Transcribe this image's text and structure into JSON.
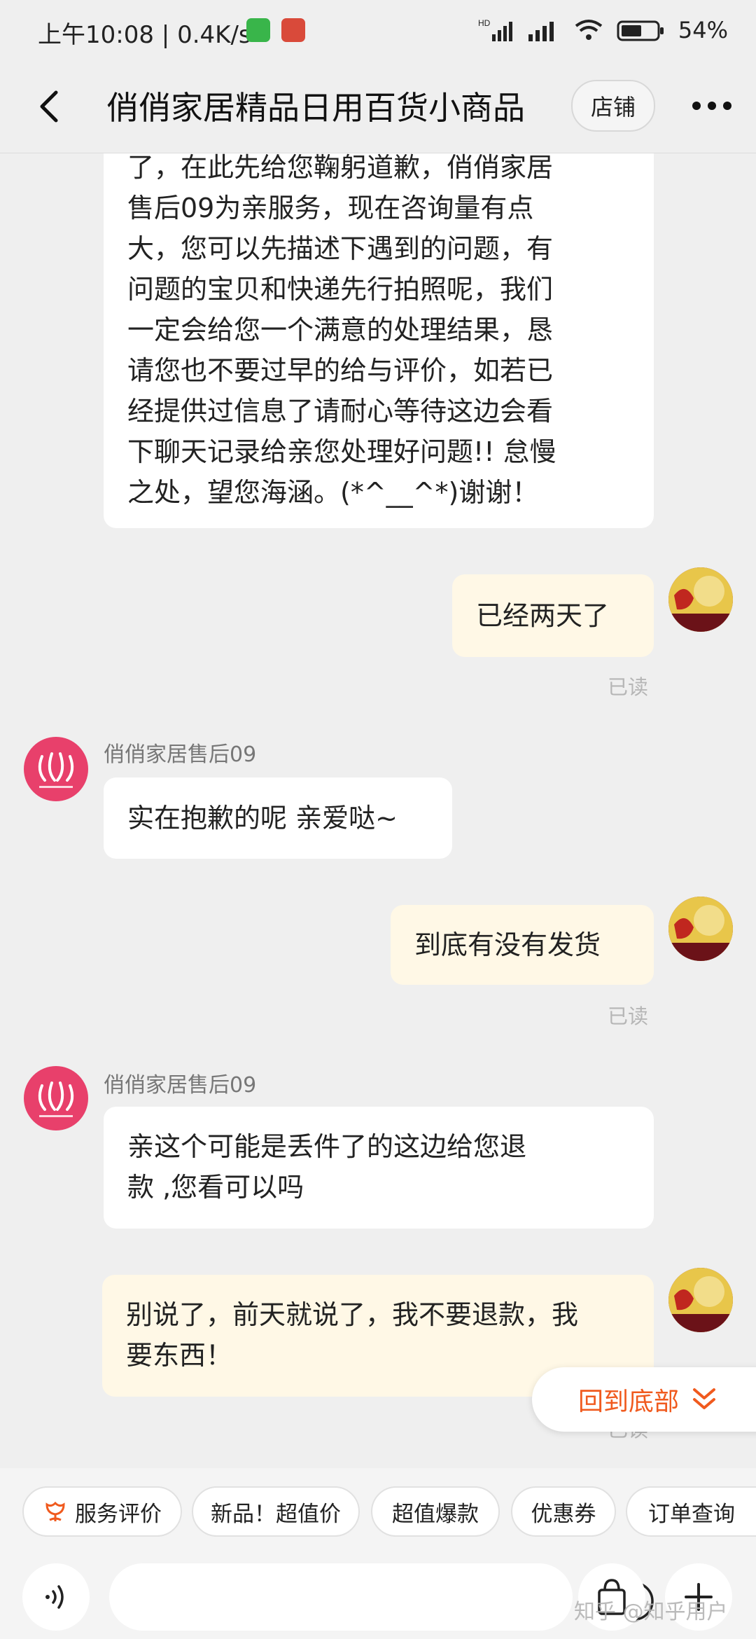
{
  "status_bar": {
    "time": "上午10:08",
    "separator": "|",
    "speed": "0.4K/s",
    "battery": "54%",
    "icons": [
      "wechat-icon",
      "toutiao-icon",
      "hd-signal-icon",
      "signal-icon",
      "wifi-icon",
      "battery-icon"
    ]
  },
  "header": {
    "title": "俏俏家居精品日用百货小商品",
    "shop_button": "店铺"
  },
  "messages": {
    "m1": {
      "lines": [
        "了，在此先给您鞠躬道歉，俏俏家居",
        "售后09为亲服务，现在咨询量有点",
        "大，您可以先描述下遇到的问题，有",
        "问题的宝贝和快递先行拍照呢，我们",
        "一定会给您一个满意的处理结果，恳",
        "请您也不要过早的给与评价，如若已",
        "经提供过信息了请耐心等待这边会看",
        "下聊天记录给亲您处理好问题!! 怠慢",
        "之处，望您海涵。(*^__^*)谢谢！"
      ]
    },
    "m2": {
      "text": "已经两天了",
      "status": "已读"
    },
    "m3": {
      "sender": "俏俏家居售后09",
      "text": "实在抱歉的呢 亲爱哒~"
    },
    "m4": {
      "text": "到底有没有发货",
      "status": "已读"
    },
    "m5": {
      "sender": "俏俏家居售后09",
      "lines": [
        "亲这个可能是丢件了的这边给您退",
        "款 ,您看可以吗"
      ]
    },
    "m6": {
      "lines": [
        "别说了，前天就说了，我不要退款，我",
        "要东西！"
      ],
      "status": "已读"
    }
  },
  "jump_bottom": "回到底部",
  "quick_actions": [
    "服务评价",
    "新品！超值价",
    "超值爆款",
    "优惠券",
    "订单查询"
  ],
  "watermark": "知乎 @知乎用户",
  "colors": {
    "background": "#efefef",
    "my_bubble": "#fff8e6",
    "accent": "#f05a1e",
    "shop_avatar": "#e8406b"
  }
}
